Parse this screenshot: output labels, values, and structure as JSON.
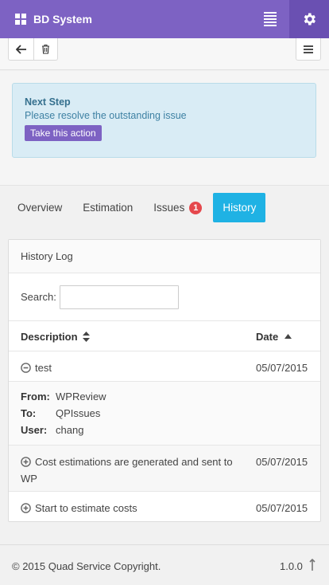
{
  "app": {
    "title": "BD System"
  },
  "toolbar": {
    "back_icon": "arrow-left-icon",
    "trash_icon": "trash-icon",
    "list_icon": "list-icon"
  },
  "alert": {
    "title": "Next Step",
    "text": "Please resolve the outstanding issue",
    "action_label": "Take this action"
  },
  "tabs": [
    {
      "label": "Overview"
    },
    {
      "label": "Estimation"
    },
    {
      "label": "Issues",
      "badge": "1"
    },
    {
      "label": "History"
    }
  ],
  "panel": {
    "title": "History Log",
    "search_label": "Search:",
    "search_value": ""
  },
  "table": {
    "columns": [
      "Description",
      "Date"
    ],
    "rows": [
      {
        "description": "test",
        "date": "05/07/2015",
        "expanded": true,
        "details": [
          {
            "key": "From:",
            "value": "WPReview"
          },
          {
            "key": "To:",
            "value": "QPIssues"
          },
          {
            "key": "User:",
            "value": "chang"
          }
        ]
      },
      {
        "description": "Cost estimations are generated and sent to WP",
        "date": "05/07/2015",
        "expanded": false
      },
      {
        "description": "Start to estimate costs",
        "date": "05/07/2015",
        "expanded": false
      }
    ]
  },
  "footer": {
    "copyright": "© 2015 Quad Service Copyright.",
    "version": "1.0.0"
  },
  "colors": {
    "brand": "#7d62c3",
    "brand_dark": "#6a50b2",
    "active_tab": "#1fb2e4",
    "badge": "#e5484d",
    "alert_bg": "#d9ecf5"
  }
}
